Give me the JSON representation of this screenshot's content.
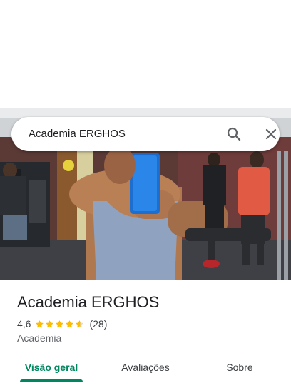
{
  "search": {
    "query": "Academia ERGHOS",
    "search_icon": "search-icon",
    "close_icon": "close-icon"
  },
  "photo": {
    "description_icon": "gym-photo"
  },
  "place": {
    "name": "Academia ERGHOS",
    "rating": "4,6",
    "rating_value": 4.6,
    "stars_max": 5,
    "review_count": "(28)",
    "category": "Academia"
  },
  "tabs": [
    {
      "label": "Visão geral",
      "active": true
    },
    {
      "label": "Avaliações",
      "active": false
    },
    {
      "label": "Sobre",
      "active": false
    }
  ],
  "colors": {
    "accent": "#01875f",
    "star": "#fbbc04",
    "star_empty": "#dadce0"
  }
}
